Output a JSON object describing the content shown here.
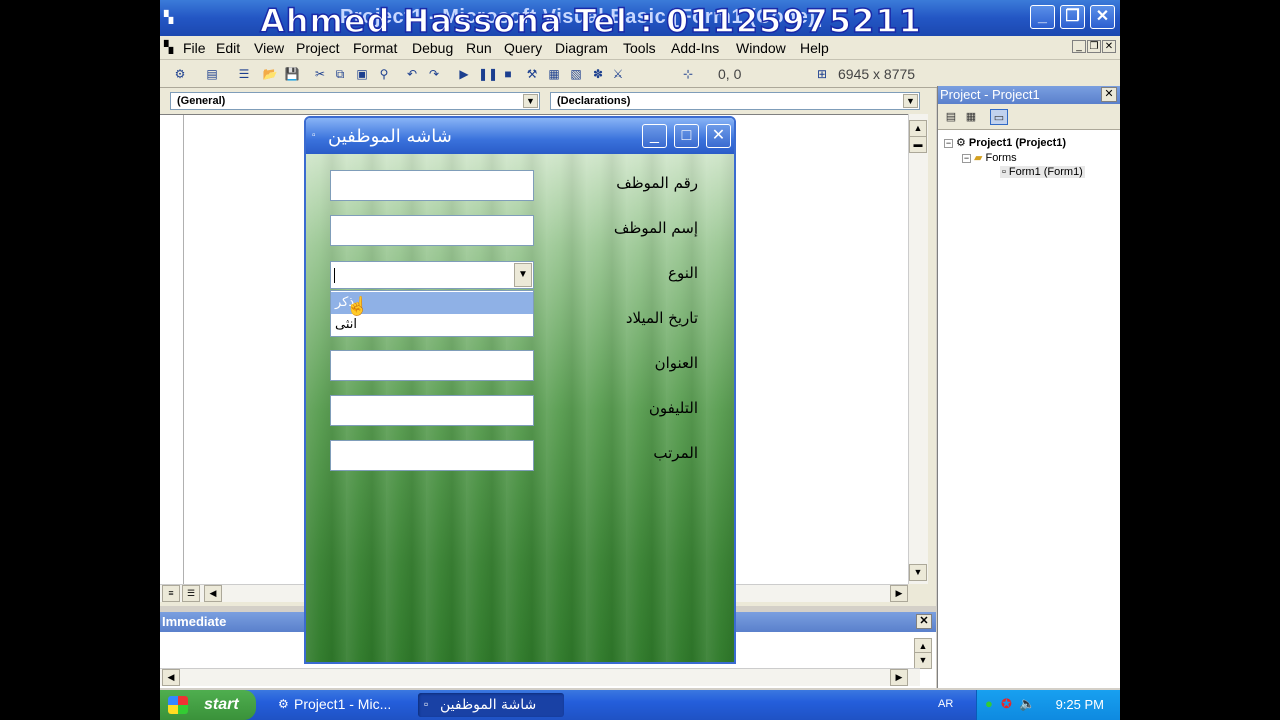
{
  "window": {
    "title": "Project1 - Microsoft Visual Basic [Form1 (Code)]",
    "watermark": "Ahmed Hassona Tel : 01125975211",
    "buttons": {
      "minimize": "_",
      "maximize": "❐",
      "close": "✕"
    }
  },
  "menu": [
    "File",
    "Edit",
    "View",
    "Project",
    "Format",
    "Debug",
    "Run",
    "Query",
    "Diagram",
    "Tools",
    "Add-Ins",
    "Window",
    "Help"
  ],
  "toolbar": {
    "position": "0, 0",
    "size": "6945 x 8775"
  },
  "code": {
    "object_combo": "(General)",
    "proc_combo": "(Declarations)"
  },
  "immediate": {
    "title": "Immediate"
  },
  "project_explorer": {
    "title": "Project - Project1",
    "tree": [
      "Project1 (Project1)",
      "Forms",
      "Form1 (Form1)"
    ]
  },
  "form": {
    "title": "شاشه الموظفين",
    "labels": [
      "رقم الموظف",
      "إسم الموظف",
      "النوع",
      "تاريخ الميلاد",
      "العنوان",
      "التليفون",
      "المرتب"
    ],
    "gender_options": [
      "ذكر",
      "انثى"
    ],
    "selected_option": "ذكر"
  },
  "taskbar": {
    "start": "start",
    "tasks": [
      "Project1 - Mic...",
      "شاشة الموظفين"
    ],
    "lang": "AR",
    "clock": "9:25 PM"
  },
  "colors": {
    "titlebar": "#245edb",
    "form_green": "#3a8334",
    "selection": "#8fb1e6"
  }
}
